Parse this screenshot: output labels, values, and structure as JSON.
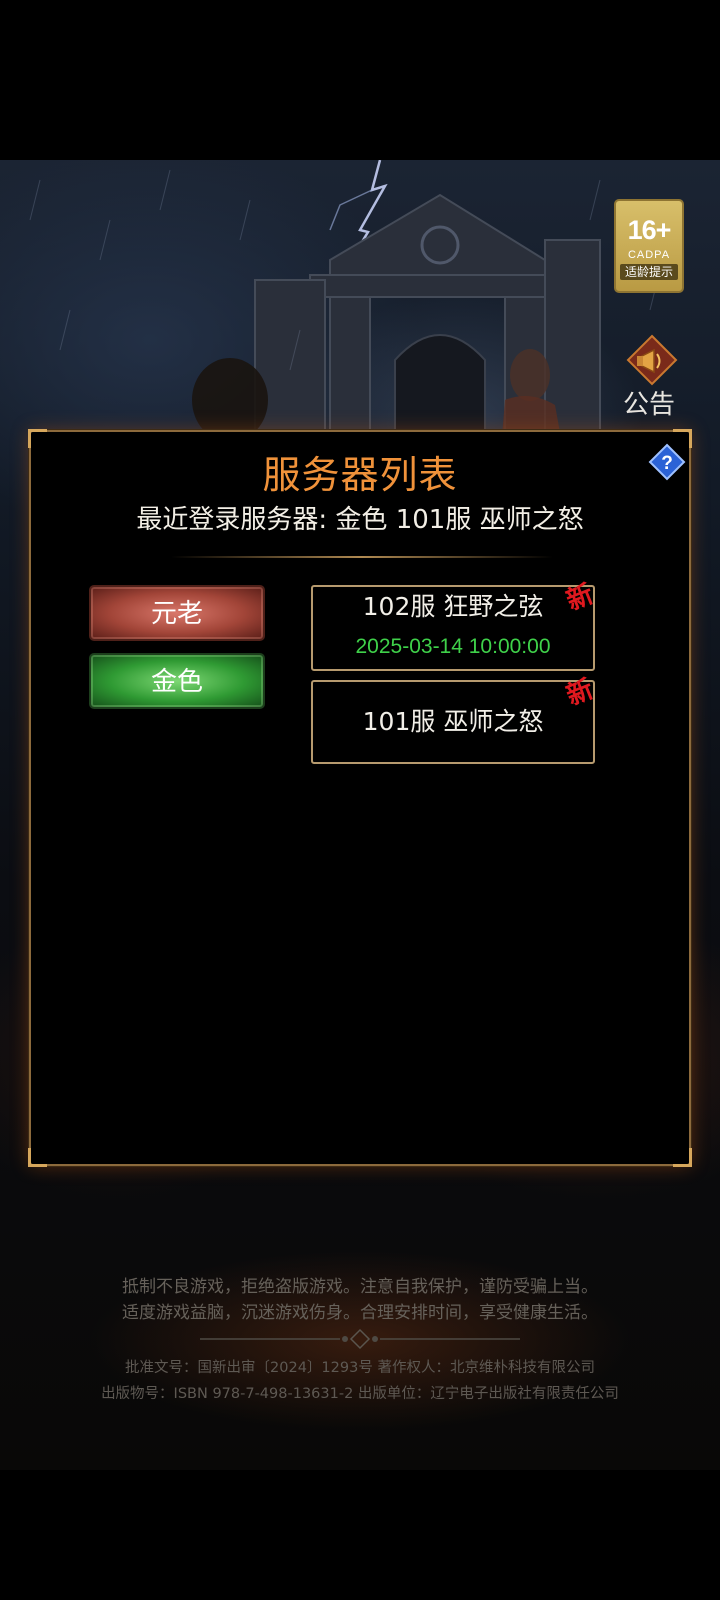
{
  "badge": {
    "age": "16+",
    "org": "CADPA",
    "tip": "适龄提示"
  },
  "notice": {
    "label": "公告"
  },
  "dialog": {
    "title": "服务器列表",
    "recent": "最近登录服务器: 金色 101服 巫师之怒",
    "categories": [
      {
        "label": "元老"
      },
      {
        "label": "金色"
      }
    ],
    "servers": [
      {
        "name": "102服 狂野之弦",
        "time": "2025-03-14 10:00:00",
        "tag": "新"
      },
      {
        "name": "101服 巫师之怒",
        "tag": "新"
      }
    ],
    "help": "?"
  },
  "footer": {
    "notice_line1": "抵制不良游戏，拒绝盗版游戏。注意自我保护，谨防受骗上当。",
    "notice_line2": "适度游戏益脑，沉迷游戏伤身。合理安排时间，享受健康生活。",
    "legal_line1": "批准文号：国新出审〔2024〕1293号  著作权人：北京维朴科技有限公司",
    "legal_line2": "出版物号：ISBN 978-7-498-13631-2  出版单位：辽宁电子出版社有限责任公司"
  },
  "colors": {
    "title": "#f0923a",
    "time": "#3fd14a",
    "new_tag": "#e0191f",
    "card_border": "#b69a6e",
    "dialog_border": "#8c6a3c"
  }
}
